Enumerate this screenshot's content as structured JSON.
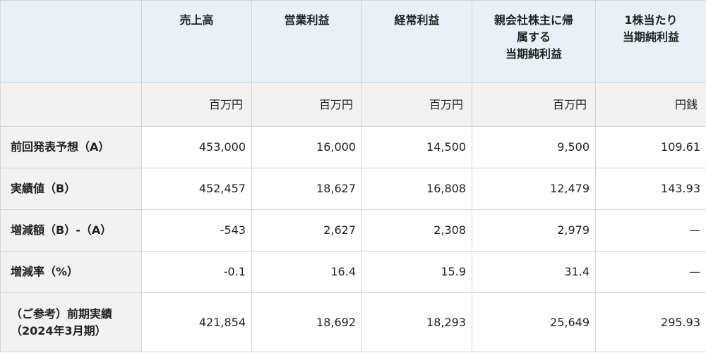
{
  "table": {
    "headers": [
      [
        ""
      ],
      [
        "売上高"
      ],
      [
        "営業利益"
      ],
      [
        "経常利益"
      ],
      [
        "親会社株主に帰",
        "属する",
        "当期純利益"
      ],
      [
        "1株当たり",
        "当期純利益"
      ]
    ],
    "units": [
      "",
      "百万円",
      "百万円",
      "百万円",
      "百万円",
      "円銭"
    ],
    "rows": [
      {
        "label": [
          "前回発表予想（A）"
        ],
        "values": [
          "453,000",
          "16,000",
          "14,500",
          "9,500",
          "109.61"
        ]
      },
      {
        "label": [
          "実績値（B）"
        ],
        "values": [
          "452,457",
          "18,627",
          "16,808",
          "12,479",
          "143.93"
        ]
      },
      {
        "label": [
          "増減額（B）-（A）"
        ],
        "values": [
          "-543",
          "2,627",
          "2,308",
          "2,979",
          "—"
        ]
      },
      {
        "label": [
          "増減率（%）"
        ],
        "values": [
          "-0.1",
          "16.4",
          "15.9",
          "31.4",
          "—"
        ]
      },
      {
        "label": [
          "（ご参考）前期実績",
          "（2024年3月期）"
        ],
        "values": [
          "421,854",
          "18,692",
          "18,293",
          "25,649",
          "295.93"
        ]
      }
    ]
  }
}
